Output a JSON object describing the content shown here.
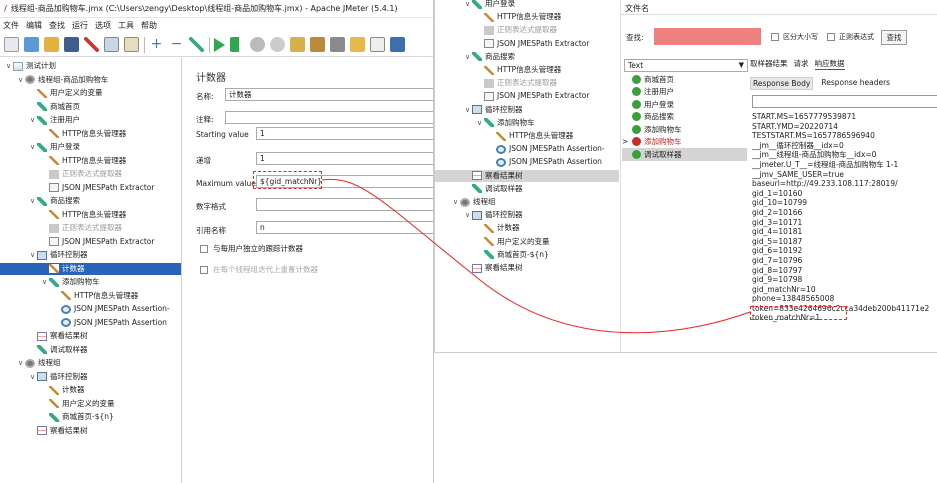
{
  "main_window": {
    "title": "线程组-商品加购物车.jmx (C:\\Users\\zengy\\Desktop\\线程组-商品加购物车.jmx) - Apache JMeter (5.4.1)",
    "menu": [
      "文件",
      "编辑",
      "查找",
      "运行",
      "选项",
      "工具",
      "帮助"
    ],
    "tree": [
      {
        "label": "测试计划",
        "icon": "plan-icon",
        "indent": 0,
        "arrow": "v"
      },
      {
        "label": "线程组-商品加购物车",
        "icon": "gear-icon",
        "indent": 1,
        "arrow": "v"
      },
      {
        "label": "用户定义的变量",
        "icon": "wrench-icon",
        "indent": 2,
        "arrow": ""
      },
      {
        "label": "商城首页",
        "icon": "pen-icon",
        "indent": 2,
        "arrow": ""
      },
      {
        "label": "注册用户",
        "icon": "pen-icon",
        "indent": 2,
        "arrow": "v"
      },
      {
        "label": "HTTP信息头管理器",
        "icon": "wrench-icon",
        "indent": 3,
        "arrow": ""
      },
      {
        "label": "用户登录",
        "icon": "pen-icon",
        "indent": 2,
        "arrow": "v"
      },
      {
        "label": "HTTP信息头管理器",
        "icon": "wrench-icon",
        "indent": 3,
        "arrow": ""
      },
      {
        "label": "正则表达式提取器",
        "icon": "regex-icon",
        "indent": 3,
        "arrow": "",
        "disabled": true
      },
      {
        "label": "JSON JMESPath Extractor",
        "icon": "json-icon",
        "indent": 3,
        "arrow": ""
      },
      {
        "label": "商品搜索",
        "icon": "pen-icon",
        "indent": 2,
        "arrow": "v"
      },
      {
        "label": "HTTP信息头管理器",
        "icon": "wrench-icon",
        "indent": 3,
        "arrow": ""
      },
      {
        "label": "正则表达式提取器",
        "icon": "regex-icon",
        "indent": 3,
        "arrow": "",
        "disabled": true
      },
      {
        "label": "JSON JMESPath Extractor",
        "icon": "json-icon",
        "indent": 3,
        "arrow": ""
      },
      {
        "label": "循环控制器",
        "icon": "loop-icon",
        "indent": 2,
        "arrow": "v"
      },
      {
        "label": "计数器",
        "icon": "wrench-icon",
        "indent": 3,
        "arrow": "",
        "selected": true
      },
      {
        "label": "添加购物车",
        "icon": "pen-icon",
        "indent": 3,
        "arrow": "v"
      },
      {
        "label": "HTTP信息头管理器",
        "icon": "wrench-icon",
        "indent": 4,
        "arrow": ""
      },
      {
        "label": "JSON JMESPath Assertion-",
        "icon": "mag-icon",
        "indent": 4,
        "arrow": ""
      },
      {
        "label": "JSON JMESPath Assertion",
        "icon": "mag-icon",
        "indent": 4,
        "arrow": ""
      },
      {
        "label": "察看结果树",
        "icon": "chart-icon",
        "indent": 2,
        "arrow": ""
      },
      {
        "label": "调试取样器",
        "icon": "pen-icon",
        "indent": 2,
        "arrow": ""
      },
      {
        "label": "线程组",
        "icon": "gear-icon",
        "indent": 1,
        "arrow": "v"
      },
      {
        "label": "循环控制器",
        "icon": "loop-icon",
        "indent": 2,
        "arrow": "v"
      },
      {
        "label": "计数器",
        "icon": "wrench-icon",
        "indent": 3,
        "arrow": ""
      },
      {
        "label": "用户定义的变量",
        "icon": "wrench-icon",
        "indent": 3,
        "arrow": ""
      },
      {
        "label": "商城首页-${n}",
        "icon": "pen-icon",
        "indent": 3,
        "arrow": ""
      },
      {
        "label": "察看结果树",
        "icon": "chart-icon",
        "indent": 2,
        "arrow": ""
      }
    ],
    "form": {
      "title": "计数器",
      "name_label": "名称:",
      "name_value": "计数器",
      "comment_label": "注释:",
      "start_label": "Starting value",
      "start_value": "1",
      "inc_label": "递增",
      "inc_value": "1",
      "max_label": "Maximum value",
      "max_value": "${gid_matchNr}",
      "format_label": "数字格式",
      "format_value": "",
      "ref_label": "引用名称",
      "ref_value": "n",
      "chk1": "与每用户独立的跟踪计数器",
      "chk2": "在每个线程组迭代上重置计数器"
    }
  },
  "result_window": {
    "file_tab": "文件名",
    "find_label": "查找:",
    "case_label": "区分大小写",
    "regex_label": "正则表达式",
    "find_button": "查找",
    "renderer": "Text",
    "tabs": [
      "取样器结果",
      "请求",
      "响应数据"
    ],
    "subtabs": [
      "Response Body",
      "Response headers"
    ],
    "tree": [
      {
        "label": "用户登录",
        "icon": "pen-icon",
        "indent": 2,
        "arrow": "v"
      },
      {
        "label": "HTTP信息头管理器",
        "icon": "wrench-icon",
        "indent": 3,
        "arrow": ""
      },
      {
        "label": "正则表达式提取器",
        "icon": "regex-icon",
        "indent": 3,
        "arrow": "",
        "disabled": true
      },
      {
        "label": "JSON JMESPath Extractor",
        "icon": "json-icon",
        "indent": 3,
        "arrow": ""
      },
      {
        "label": "商品搜索",
        "icon": "pen-icon",
        "indent": 2,
        "arrow": "v"
      },
      {
        "label": "HTTP信息头管理器",
        "icon": "wrench-icon",
        "indent": 3,
        "arrow": ""
      },
      {
        "label": "正则表达式提取器",
        "icon": "regex-icon",
        "indent": 3,
        "arrow": "",
        "disabled": true
      },
      {
        "label": "JSON JMESPath Extractor",
        "icon": "json-icon",
        "indent": 3,
        "arrow": ""
      },
      {
        "label": "循环控制器",
        "icon": "loop-icon",
        "indent": 2,
        "arrow": "v"
      },
      {
        "label": "添加购物车",
        "icon": "pen-icon",
        "indent": 3,
        "arrow": "v"
      },
      {
        "label": "HTTP信息头管理器",
        "icon": "wrench-icon",
        "indent": 4,
        "arrow": ""
      },
      {
        "label": "JSON JMESPath Assertion-",
        "icon": "mag-icon",
        "indent": 4,
        "arrow": ""
      },
      {
        "label": "JSON JMESPath Assertion",
        "icon": "mag-icon",
        "indent": 4,
        "arrow": ""
      },
      {
        "label": "察看结果树",
        "icon": "chart-icon",
        "indent": 2,
        "arrow": "",
        "selected": true
      },
      {
        "label": "调试取样器",
        "icon": "pen-icon",
        "indent": 2,
        "arrow": ""
      },
      {
        "label": "线程组",
        "icon": "gear-icon",
        "indent": 1,
        "arrow": "v"
      },
      {
        "label": "循环控制器",
        "icon": "loop-icon",
        "indent": 2,
        "arrow": "v"
      },
      {
        "label": "计数器",
        "icon": "wrench-icon",
        "indent": 3,
        "arrow": ""
      },
      {
        "label": "用户定义的变量",
        "icon": "wrench-icon",
        "indent": 3,
        "arrow": ""
      },
      {
        "label": "商城首页-${n}",
        "icon": "pen-icon",
        "indent": 3,
        "arrow": ""
      },
      {
        "label": "察看结果树",
        "icon": "chart-icon",
        "indent": 2,
        "arrow": ""
      }
    ],
    "results": [
      {
        "label": "商城首页",
        "status": "ok"
      },
      {
        "label": "注册用户",
        "status": "ok"
      },
      {
        "label": "用户登录",
        "status": "ok"
      },
      {
        "label": "商品搜索",
        "status": "ok"
      },
      {
        "label": "添加购物车",
        "status": "ok"
      },
      {
        "label": "添加购物车",
        "status": "error",
        "expand": ">"
      },
      {
        "label": "调试取样器",
        "status": "ok",
        "selected": true
      }
    ],
    "response_lines": [
      "START.MS=1657779539871",
      "START.YMD=20220714",
      "TESTSTART.MS=1657786596940",
      "__jm__循环控制器__idx=0",
      "__jm__线程组-商品加购物车__idx=0",
      "__jmeter.U_T__=线程组-商品加购物车 1-1",
      "__jmv_SAME_USER=true",
      "baseurl=http://49.233.108.117:28019/",
      "gid_1=10160",
      "gid_10=10799",
      "gid_2=10166",
      "gid_3=10171",
      "gid_4=10181",
      "gid_5=10187",
      "gid_6=10192",
      "gid_7=10796",
      "gid_8=10797",
      "gid_9=10798",
      "gid_matchNr=10",
      "phone=13848565008",
      "token=833e4264696c2cca34deb200b41171e2",
      "token_matchNr=1"
    ]
  }
}
